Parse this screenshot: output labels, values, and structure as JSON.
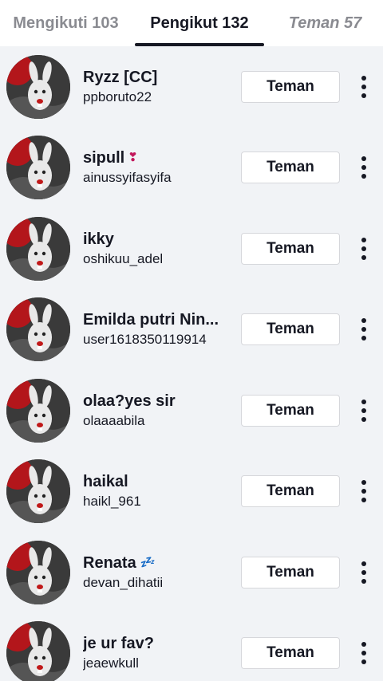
{
  "tabs": [
    {
      "label": "Mengikuti 103"
    },
    {
      "label": "Pengikut 132"
    },
    {
      "label": "Teman 57"
    }
  ],
  "active_tab": 1,
  "rows": [
    {
      "name": "Ryzz [CC]",
      "badge": "",
      "username": "ppboruto22",
      "button": "Teman"
    },
    {
      "name": "sipull",
      "badge": "❣",
      "username": "ainussyifasyifa",
      "button": "Teman"
    },
    {
      "name": "ikky",
      "badge": "",
      "username": "oshikuu_adel",
      "button": "Teman"
    },
    {
      "name": "Emilda putri Nin...",
      "badge": "",
      "username": "user1618350119914",
      "button": "Teman"
    },
    {
      "name": "olaa?yes sir",
      "badge": "",
      "username": "olaaaabila",
      "button": "Teman"
    },
    {
      "name": "haikal",
      "badge": "",
      "username": "haikl_961",
      "button": "Teman"
    },
    {
      "name": "Renata",
      "badge": "💤",
      "username": "devan_dihatii",
      "button": "Teman"
    },
    {
      "name": "je ur fav?",
      "badge": "",
      "username": "jeaewkull",
      "button": "Teman"
    }
  ]
}
